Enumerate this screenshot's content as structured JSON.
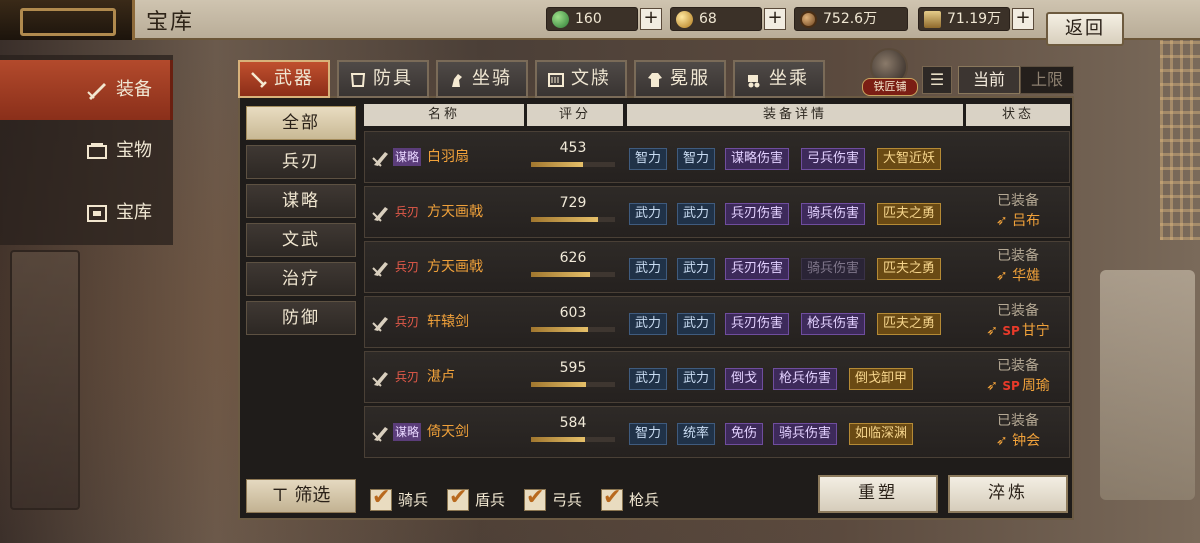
{
  "header": {
    "title": "宝库",
    "resources": [
      {
        "icon": "jade-icon",
        "value": "160",
        "color": "#3fa34d"
      },
      {
        "icon": "gold-ingot-icon",
        "value": "68",
        "color": "#d9a63a"
      },
      {
        "icon": "copper-coin-icon",
        "value": "752.6万",
        "color": "#b07a3c"
      },
      {
        "icon": "grain-icon",
        "value": "71.19万",
        "color": "#c9a65a"
      }
    ],
    "back_label": "返回"
  },
  "sidebar": {
    "items": [
      {
        "label": "装备",
        "icon": "equipment-icon",
        "active": true
      },
      {
        "label": "宝物",
        "icon": "treasure-icon",
        "active": false
      },
      {
        "label": "宝库",
        "icon": "vault-icon",
        "active": false
      }
    ]
  },
  "tabs": [
    {
      "label": "武器",
      "icon": "sword-icon",
      "active": true
    },
    {
      "label": "防具",
      "icon": "armor-icon",
      "active": false
    },
    {
      "label": "坐骑",
      "icon": "horse-icon",
      "active": false
    },
    {
      "label": "文牍",
      "icon": "scroll-icon",
      "active": false
    },
    {
      "label": "冕服",
      "icon": "robe-icon",
      "active": false
    },
    {
      "label": "坐乘",
      "icon": "carriage-icon",
      "active": false
    }
  ],
  "toolbar": {
    "blacksmith_label": "铁匠铺",
    "current_label": "当前",
    "limit_label": "上限"
  },
  "categories": [
    "全部",
    "兵刃",
    "谋略",
    "文武",
    "治疗",
    "防御"
  ],
  "active_category": "全部",
  "filter_label": "筛选",
  "table": {
    "headers": [
      "名称",
      "评分",
      "装备详情",
      "状态"
    ],
    "rows": [
      {
        "kind": "谋略",
        "name": "白羽扇",
        "score": "453",
        "score_pct": 0.62,
        "tags": [
          {
            "t": "智力",
            "c": "blue"
          },
          {
            "t": "智力",
            "c": "blue"
          },
          {
            "t": "谋略伤害",
            "c": "purple"
          },
          {
            "t": "弓兵伤害",
            "c": "purple"
          },
          {
            "t": "大智近妖",
            "c": "gold"
          }
        ],
        "status": "",
        "owner": "",
        "sp": false
      },
      {
        "kind": "兵刃",
        "name": "方天画戟",
        "score": "729",
        "score_pct": 0.8,
        "tags": [
          {
            "t": "武力",
            "c": "blue"
          },
          {
            "t": "武力",
            "c": "blue"
          },
          {
            "t": "兵刃伤害",
            "c": "purple"
          },
          {
            "t": "骑兵伤害",
            "c": "purple"
          },
          {
            "t": "匹夫之勇",
            "c": "gold"
          }
        ],
        "status": "已装备",
        "owner": "吕布",
        "sp": false
      },
      {
        "kind": "兵刃",
        "name": "方天画戟",
        "score": "626",
        "score_pct": 0.7,
        "tags": [
          {
            "t": "武力",
            "c": "blue"
          },
          {
            "t": "武力",
            "c": "blue"
          },
          {
            "t": "兵刃伤害",
            "c": "purple"
          },
          {
            "t": "骑兵伤害",
            "c": "dim"
          },
          {
            "t": "匹夫之勇",
            "c": "gold"
          }
        ],
        "status": "已装备",
        "owner": "华雄",
        "sp": false
      },
      {
        "kind": "兵刃",
        "name": "轩辕剑",
        "score": "603",
        "score_pct": 0.68,
        "tags": [
          {
            "t": "武力",
            "c": "blue"
          },
          {
            "t": "武力",
            "c": "blue"
          },
          {
            "t": "兵刃伤害",
            "c": "purple"
          },
          {
            "t": "枪兵伤害",
            "c": "purple"
          },
          {
            "t": "匹夫之勇",
            "c": "gold"
          }
        ],
        "status": "已装备",
        "owner": "甘宁",
        "sp": true
      },
      {
        "kind": "兵刃",
        "name": "湛卢",
        "score": "595",
        "score_pct": 0.66,
        "tags": [
          {
            "t": "武力",
            "c": "blue"
          },
          {
            "t": "武力",
            "c": "blue"
          },
          {
            "t": "倒戈",
            "c": "purple"
          },
          {
            "t": "枪兵伤害",
            "c": "purple"
          },
          {
            "t": "倒戈卸甲",
            "c": "gold"
          }
        ],
        "status": "已装备",
        "owner": "周瑜",
        "sp": true
      },
      {
        "kind": "谋略",
        "name": "倚天剑",
        "score": "584",
        "score_pct": 0.64,
        "tags": [
          {
            "t": "智力",
            "c": "blue"
          },
          {
            "t": "统率",
            "c": "blue"
          },
          {
            "t": "免伤",
            "c": "purple"
          },
          {
            "t": "骑兵伤害",
            "c": "purple"
          },
          {
            "t": "如临深渊",
            "c": "gold"
          }
        ],
        "status": "已装备",
        "owner": "钟会",
        "sp": false
      }
    ],
    "sp_label": "SP"
  },
  "unit_filters": [
    {
      "label": "骑兵",
      "checked": true
    },
    {
      "label": "盾兵",
      "checked": true
    },
    {
      "label": "弓兵",
      "checked": true
    },
    {
      "label": "枪兵",
      "checked": true
    }
  ],
  "buttons": {
    "reforge": "重塑",
    "temper": "淬炼"
  }
}
